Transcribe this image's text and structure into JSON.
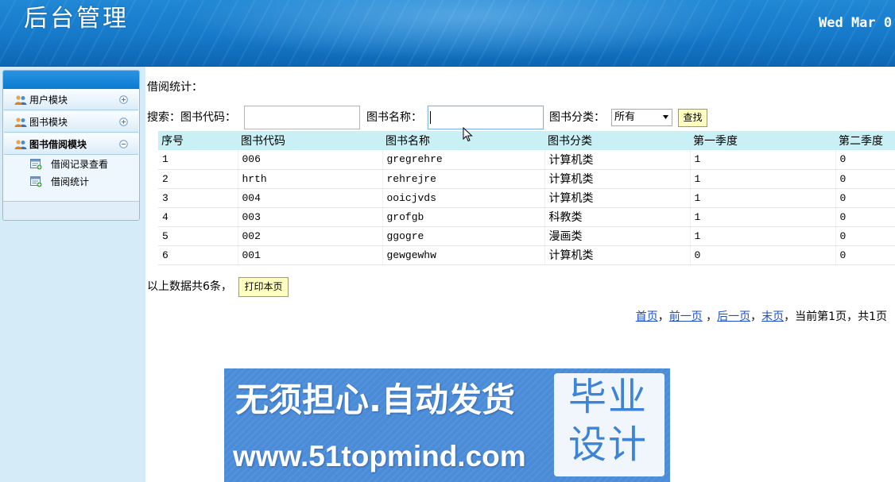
{
  "header": {
    "title": "后台管理",
    "date": "Wed Mar 0"
  },
  "sidebar": {
    "modules": [
      {
        "label": "用户模块",
        "icon": "users-icon",
        "toggle_icon": "expand-icon",
        "expanded": false
      },
      {
        "label": "图书模块",
        "icon": "users-icon",
        "toggle_icon": "expand-icon",
        "expanded": false
      },
      {
        "label": "图书借阅模块",
        "icon": "users-icon",
        "toggle_icon": "collapse-icon",
        "expanded": true,
        "items": [
          {
            "label": "借阅记录查看",
            "icon": "form-icon"
          },
          {
            "label": "借阅统计",
            "icon": "form-icon"
          }
        ]
      }
    ]
  },
  "main": {
    "section_title": "借阅统计：",
    "search": {
      "prefix": "搜索：",
      "code_label": "图书代码：",
      "code_value": "",
      "name_label": "图书名称：",
      "name_value": "",
      "category_label": "图书分类：",
      "category_selected": "所有",
      "search_button": "查找"
    },
    "table": {
      "columns": [
        "序号",
        "图书代码",
        "图书名称",
        "图书分类",
        "第一季度",
        "第二季度"
      ],
      "rows": [
        [
          "1",
          "006",
          "gregrehre",
          "计算机类",
          "1",
          "0"
        ],
        [
          "2",
          "hrth",
          "rehrejre",
          "计算机类",
          "1",
          "0"
        ],
        [
          "3",
          "004",
          "ooicjvds",
          "计算机类",
          "1",
          "0"
        ],
        [
          "4",
          "003",
          "grofgb",
          "科教类",
          "1",
          "0"
        ],
        [
          "5",
          "002",
          "ggogre",
          "漫画类",
          "1",
          "0"
        ],
        [
          "6",
          "001",
          "gewgewhw",
          "计算机类",
          "0",
          "0"
        ]
      ]
    },
    "summary": "以上数据共6条，",
    "print_button": "打印本页",
    "pagination": {
      "first": "首页",
      "sep_after_first": "，",
      "prev": "前一页",
      "sep_after_prev": " ，",
      "next": "后一页",
      "sep_after_next": "，",
      "last": "末页",
      "sep_after_last": "，",
      "status": "当前第1页，共1页"
    }
  },
  "watermark": {
    "slogan": "无须担心.自动发货",
    "url": "www.51topmind.com",
    "badge_line1": "毕业",
    "badge_line2": "设计"
  },
  "colors": {
    "header_bg": "#1679c9",
    "sidebar_bg": "#d6ebf8",
    "panel_head": "#0a7bd0",
    "table_header_bg": "#c8f0f5",
    "button_bg": "#ffffc0",
    "link": "#1e4fc8",
    "watermark_bg": "#4b8cd8",
    "watermark_badge_text": "#3d84d6"
  }
}
